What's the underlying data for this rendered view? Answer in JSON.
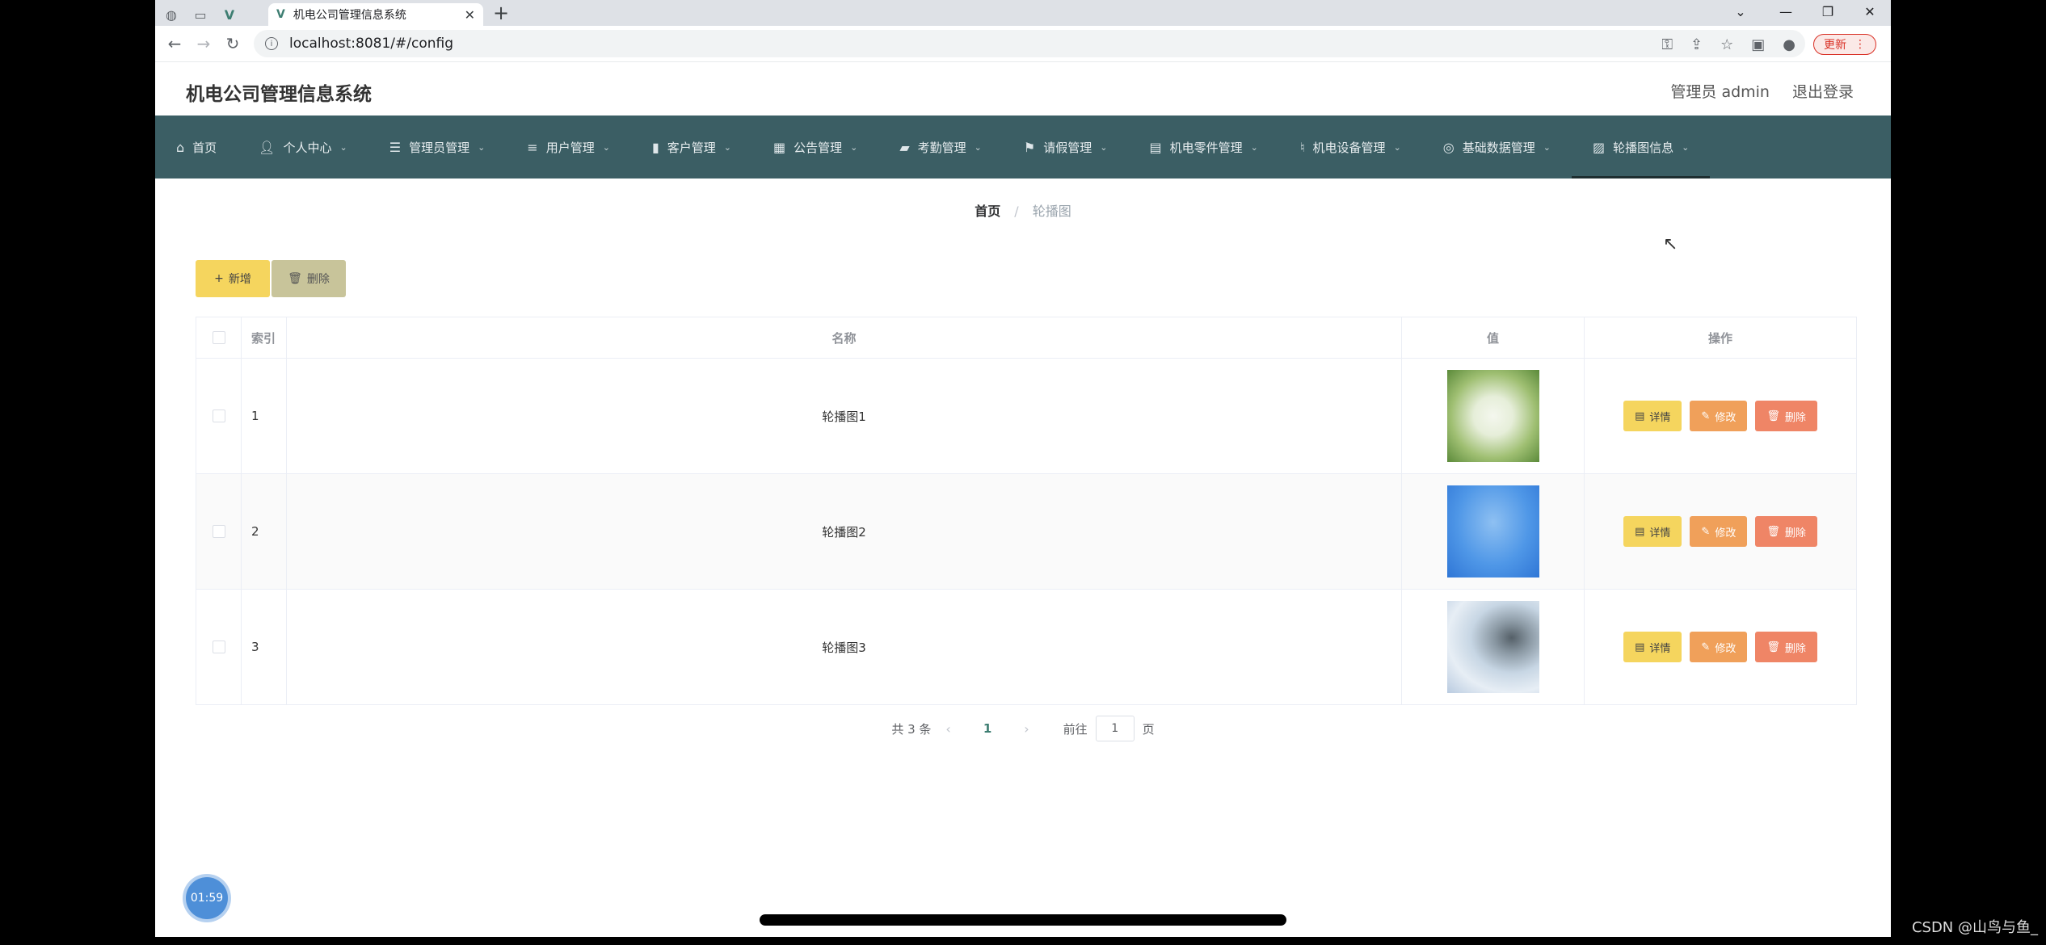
{
  "browser": {
    "tab_title": "机电公司管理信息系统",
    "url": "localhost:8081/#/config",
    "update_label": "更新"
  },
  "header": {
    "site_title": "机电公司管理信息系统",
    "user_label": "管理员 admin",
    "logout_label": "退出登录"
  },
  "menu": {
    "items": [
      {
        "label": "首页",
        "icon": "home-icon",
        "has_caret": false
      },
      {
        "label": "个人中心",
        "icon": "user-icon",
        "has_caret": true
      },
      {
        "label": "管理员管理",
        "icon": "sliders-icon",
        "has_caret": true
      },
      {
        "label": "用户管理",
        "icon": "list-icon",
        "has_caret": true
      },
      {
        "label": "客户管理",
        "icon": "bar-chart-icon",
        "has_caret": true
      },
      {
        "label": "公告管理",
        "icon": "grid-icon",
        "has_caret": true
      },
      {
        "label": "考勤管理",
        "icon": "briefcase-icon",
        "has_caret": true
      },
      {
        "label": "请假管理",
        "icon": "flag-icon",
        "has_caret": true
      },
      {
        "label": "机电零件管理",
        "icon": "book-icon",
        "has_caret": true
      },
      {
        "label": "机电设备管理",
        "icon": "microphone-icon",
        "has_caret": true
      },
      {
        "label": "基础数据管理",
        "icon": "globe-icon",
        "has_caret": true
      },
      {
        "label": "轮播图信息",
        "icon": "image-icon",
        "has_caret": true
      }
    ],
    "active_index": 11
  },
  "breadcrumb": {
    "home": "首页",
    "separator": "/",
    "current": "轮播图"
  },
  "toolbar": {
    "add_label": "新增",
    "delete_label": "删除"
  },
  "table": {
    "columns": [
      "索引",
      "名称",
      "值",
      "操作"
    ],
    "rows": [
      {
        "index": "1",
        "name": "轮播图1",
        "thumb": "green-blurred-foliage"
      },
      {
        "index": "2",
        "name": "轮播图2",
        "thumb": "blue-sky"
      },
      {
        "index": "3",
        "name": "轮播图3",
        "thumb": "snowy-tree"
      }
    ],
    "actions": {
      "detail": "详情",
      "edit": "修改",
      "delete": "删除"
    }
  },
  "pagination": {
    "total_text": "共 3 条",
    "current_page": "1",
    "goto_prefix": "前往",
    "goto_value": "1",
    "goto_suffix": "页"
  },
  "overlay": {
    "timer": "01:59",
    "watermark": "CSDN @山鸟与鱼_"
  },
  "colors": {
    "menu_bg": "#3b5e64",
    "accent": "#3e7e72",
    "btn_add": "#f5d55e",
    "btn_edit": "#f0a05a",
    "btn_delete": "#ef8566"
  }
}
